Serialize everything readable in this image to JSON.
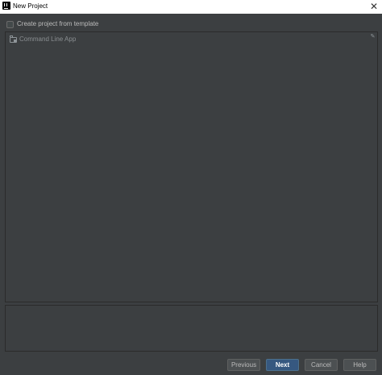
{
  "window": {
    "title": "New Project",
    "close_symbol": "✕",
    "app_icon": "intellij-icon"
  },
  "template_option": {
    "label": "Create project from template",
    "checked": false
  },
  "templates": {
    "items": [
      {
        "label": "Command Line App",
        "icon": "folder-icon"
      }
    ],
    "edit_symbol": "✎"
  },
  "description": {
    "text": ""
  },
  "buttons": {
    "previous": "Previous",
    "next": "Next",
    "cancel": "Cancel",
    "help": "Help"
  },
  "colors": {
    "background": "#3c3f41",
    "primary_button": "#365880",
    "title_bar": "#ffffff"
  }
}
